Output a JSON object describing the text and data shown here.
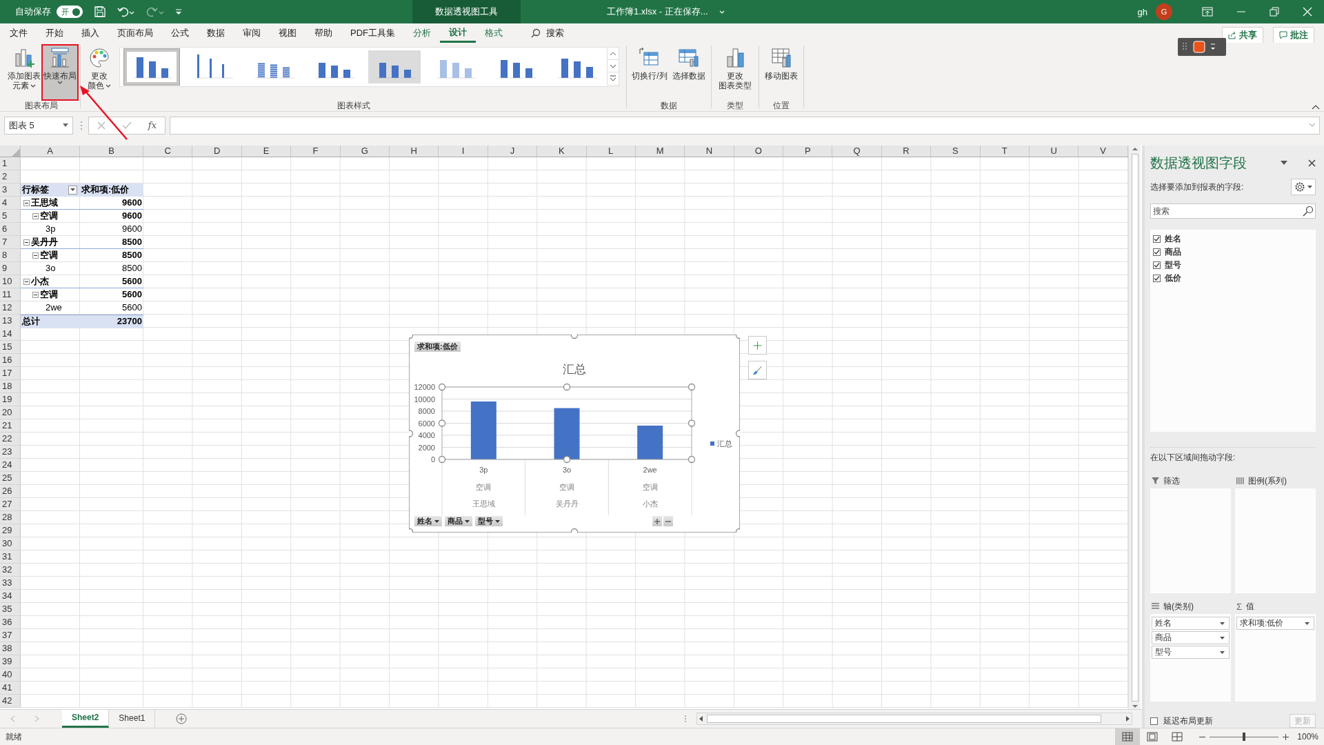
{
  "title_bar": {
    "autosave_label": "自动保存",
    "autosave_on": true,
    "autosave_state": "开",
    "context_label": "数据透视图工具",
    "document_title": "工作簿1.xlsx  -  正在保存...",
    "user_name": "gh",
    "avatar_initial": "G"
  },
  "menu_tabs": [
    {
      "label": "文件",
      "selected": false,
      "contextual": false
    },
    {
      "label": "开始",
      "selected": false,
      "contextual": false
    },
    {
      "label": "插入",
      "selected": false,
      "contextual": false
    },
    {
      "label": "页面布局",
      "selected": false,
      "contextual": false
    },
    {
      "label": "公式",
      "selected": false,
      "contextual": false
    },
    {
      "label": "数据",
      "selected": false,
      "contextual": false
    },
    {
      "label": "审阅",
      "selected": false,
      "contextual": false
    },
    {
      "label": "视图",
      "selected": false,
      "contextual": false
    },
    {
      "label": "帮助",
      "selected": false,
      "contextual": false
    },
    {
      "label": "PDF工具集",
      "selected": false,
      "contextual": false
    },
    {
      "label": "分析",
      "selected": false,
      "contextual": true
    },
    {
      "label": "设计",
      "selected": true,
      "contextual": true
    },
    {
      "label": "格式",
      "selected": false,
      "contextual": true
    }
  ],
  "search_label": "搜索",
  "share_button": "共享",
  "comments_button": "批注",
  "ribbon": {
    "groups": [
      {
        "label": "图表布局",
        "items": [
          {
            "kind": "add-element",
            "lines": [
              "添加图表",
              "元素"
            ],
            "dropdown": true,
            "highlighted": false
          },
          {
            "kind": "quick-layout",
            "lines": [
              "快速布局"
            ],
            "dropdown": true,
            "highlighted": true
          }
        ]
      },
      {
        "label": "图表样式",
        "items": [
          {
            "kind": "colors",
            "lines": [
              "更改",
              "颜色"
            ],
            "dropdown": true,
            "highlighted": false
          },
          {
            "kind": "gallery",
            "styles": [
              {
                "selected": true
              },
              {
                "selected": false
              },
              {
                "selected": false
              },
              {
                "selected": false
              },
              {
                "selected": false
              },
              {
                "selected": false
              },
              {
                "selected": false
              },
              {
                "selected": false
              }
            ]
          }
        ]
      },
      {
        "label": "数据",
        "items": [
          {
            "kind": "switch",
            "lines": [
              "切换行/列"
            ],
            "dropdown": false,
            "highlighted": false
          },
          {
            "kind": "select-data",
            "lines": [
              "选择数据"
            ],
            "dropdown": false,
            "highlighted": false
          }
        ]
      },
      {
        "label": "类型",
        "items": [
          {
            "kind": "change-type",
            "lines": [
              "更改",
              "图表类型"
            ],
            "dropdown": false,
            "highlighted": false
          }
        ]
      },
      {
        "label": "位置",
        "items": [
          {
            "kind": "move",
            "lines": [
              "移动图表"
            ],
            "dropdown": false,
            "highlighted": false
          }
        ]
      }
    ]
  },
  "formula_bar": {
    "name_box": "图表 5",
    "function_label": "fx"
  },
  "sheet": {
    "columns": [
      "A",
      "B",
      "C",
      "D",
      "E",
      "F",
      "G",
      "H",
      "I",
      "J",
      "K",
      "L",
      "M",
      "N",
      "O",
      "P",
      "Q",
      "R",
      "S",
      "T",
      "U",
      "V"
    ],
    "row_headers": [
      "1",
      "2",
      "3",
      "4",
      "5",
      "6",
      "7",
      "8",
      "9",
      "10",
      "11",
      "12",
      "13",
      "14",
      "15",
      "16",
      "17",
      "18",
      "19",
      "20",
      "21",
      "22",
      "23",
      "24",
      "25",
      "26",
      "27",
      "28",
      "29",
      "30",
      "31",
      "32",
      "33",
      "34",
      "35",
      "36",
      "37",
      "38",
      "39",
      "40",
      "41",
      "42"
    ],
    "pivot": {
      "header": [
        "行标签",
        "求和项:低价"
      ],
      "rows": [
        {
          "label": "王思域",
          "value": "9600",
          "expanded": true,
          "children": [
            {
              "label": "空调",
              "value": "9600",
              "expanded": true,
              "children": [
                {
                  "label": "3p",
                  "value": "9600"
                }
              ]
            }
          ]
        },
        {
          "label": "吴丹丹",
          "value": "8500",
          "expanded": true,
          "children": [
            {
              "label": "空调",
              "value": "8500",
              "expanded": true,
              "children": [
                {
                  "label": "3o",
                  "value": "8500"
                }
              ]
            }
          ]
        },
        {
          "label": "小杰",
          "value": "5600",
          "expanded": true,
          "children": [
            {
              "label": "空调",
              "value": "5600",
              "expanded": true,
              "children": [
                {
                  "label": "2we",
                  "value": "5600"
                }
              ]
            }
          ]
        }
      ],
      "total": {
        "label": "总计",
        "value": "23700"
      }
    },
    "chart": {
      "value_field": "求和项:低价",
      "axis_fields": [
        "姓名",
        "商品",
        "型号"
      ],
      "category_levels": [
        [
          "空调",
          "空调",
          "空调"
        ],
        [
          "王思域",
          "吴丹丹",
          "小杰"
        ]
      ],
      "chart_data": {
        "type": "bar",
        "title": "汇总",
        "categories": [
          "3p",
          "3o",
          "2we"
        ],
        "series": [
          {
            "name": "汇总",
            "color": "#4472c4",
            "values": [
              9600,
              8500,
              5600
            ]
          }
        ],
        "grid": true,
        "ylim": [
          0,
          12000
        ],
        "yticks": [
          0,
          2000,
          4000,
          6000,
          8000,
          10000,
          12000
        ]
      }
    }
  },
  "field_pane": {
    "title": "数据透视图字段",
    "prompt": "选择要添加到报表的字段:",
    "search_placeholder": "搜索",
    "fields": [
      {
        "label": "姓名",
        "checked": true
      },
      {
        "label": "商品",
        "checked": true
      },
      {
        "label": "型号",
        "checked": true
      },
      {
        "label": "低价",
        "checked": true
      }
    ],
    "areas_hint": "在以下区域间拖动字段:",
    "areas": [
      {
        "kind": "filter",
        "label": "筛选"
      },
      {
        "kind": "legend",
        "label": "图例(系列)"
      },
      {
        "kind": "axis",
        "label": "轴(类别)",
        "items": [
          "姓名",
          "商品",
          "型号"
        ]
      },
      {
        "kind": "values",
        "symbol": "Σ",
        "label": "值",
        "items": [
          "求和项:低价"
        ]
      }
    ],
    "defer_update": {
      "label": "延迟布局更新",
      "checked": false
    },
    "update_button": {
      "label": "更新",
      "disabled": true
    }
  },
  "sheet_tabs": [
    {
      "label": "Sheet2",
      "selected": true
    },
    {
      "label": "Sheet1",
      "selected": false
    }
  ],
  "status_bar": {
    "status": "就绪",
    "views": [
      {
        "kind": "normal",
        "selected": true
      },
      {
        "kind": "page-layout",
        "selected": false
      },
      {
        "kind": "page-break",
        "selected": false
      }
    ],
    "zoom": {
      "level": 0.5
    },
    "zoom_label": "100%"
  }
}
